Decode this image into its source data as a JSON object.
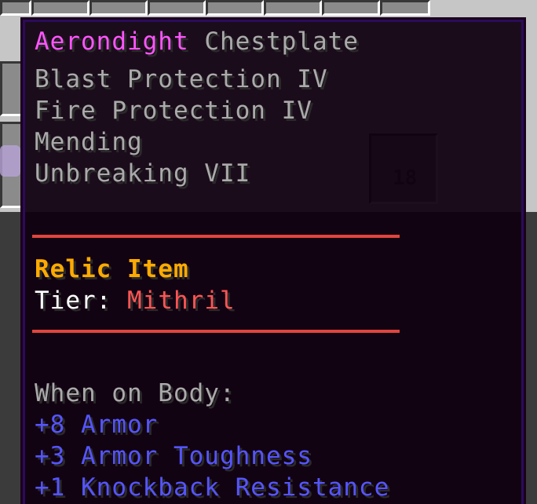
{
  "item": {
    "name": "Aerondight",
    "type": "Chestplate",
    "name_color": "#ff55ff",
    "type_color": "#aaaaaa"
  },
  "enchantments": [
    "Blast Protection IV",
    "Fire Protection IV",
    "Mending",
    "Unbreaking VII"
  ],
  "relic": {
    "label": "Relic Item",
    "label_color": "#ffaa00",
    "tier_label": "Tier:",
    "tier_value": "Mithril",
    "tier_value_color": "#ff5555"
  },
  "attributes": {
    "header": "When on Body:",
    "lines": [
      "+8 Armor",
      "+3 Armor Toughness",
      "+1 Knockback Resistance"
    ],
    "color": "#5555ff"
  },
  "slot": {
    "count": "18"
  },
  "colors": {
    "divider": "#e0453f",
    "tooltip_bg": "#100010",
    "tooltip_border": "#2b0b5a",
    "enchant_text": "#aaaaaa"
  }
}
